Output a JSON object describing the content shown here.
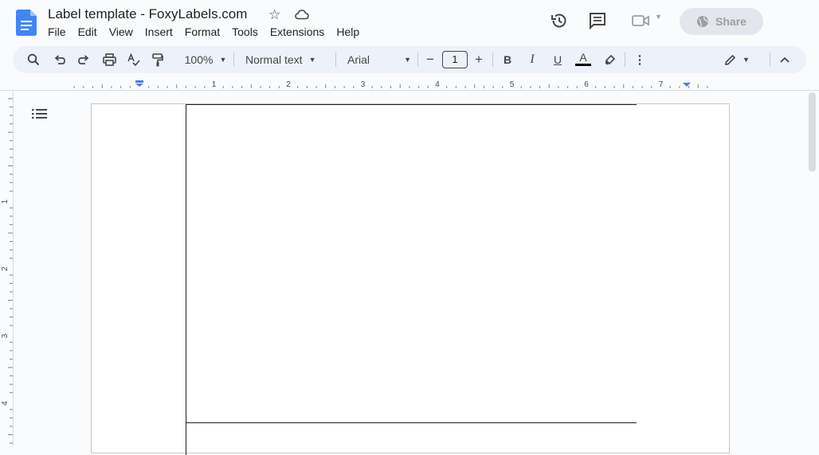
{
  "document": {
    "title": "Label template - FoxyLabels.com"
  },
  "menu": [
    "File",
    "Edit",
    "View",
    "Insert",
    "Format",
    "Tools",
    "Extensions",
    "Help"
  ],
  "header": {
    "share_label": "Share"
  },
  "toolbar": {
    "zoom": "100%",
    "style": "Normal text",
    "font": "Arial",
    "font_size": "1",
    "minus": "−",
    "plus": "+",
    "bold": "B",
    "italic": "I",
    "underline": "U",
    "text_color_letter": "A",
    "more": "⋮"
  },
  "ruler": {
    "horizontal_numbers": [
      "1",
      "2",
      "3",
      "4",
      "5",
      "6",
      "7"
    ],
    "vertical_numbers": [
      "1",
      "2",
      "3",
      "4"
    ]
  },
  "icons": {
    "search": "search-icon",
    "undo": "undo-icon",
    "redo": "redo-icon",
    "print": "print-icon",
    "spellcheck": "spellcheck-icon",
    "paint_format": "paint-format-icon",
    "highlighter": "highlighter-icon",
    "editing_mode": "pencil-icon",
    "collapse": "chevron-up-icon",
    "history": "history-icon",
    "comments": "comment-icon",
    "meet": "video-icon",
    "outline": "outline-icon",
    "star": "star-icon",
    "cloud": "cloud-icon",
    "globe": "globe-icon"
  },
  "colors": {
    "docs_blue": "#4285f4",
    "toolbar_bg": "#edf2fa",
    "share_bg": "#e3e7ed",
    "ruler_marker": "#4a7fe8"
  }
}
